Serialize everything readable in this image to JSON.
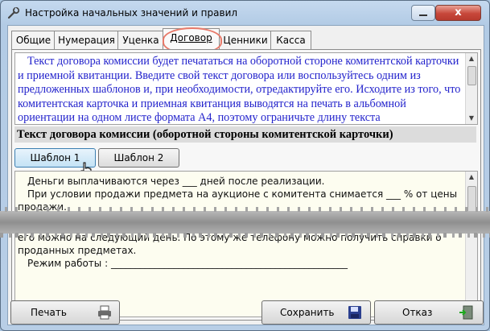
{
  "window": {
    "title": "Настройка начальных значений и правил",
    "close_glyph": "x"
  },
  "tabs": [
    {
      "label": "Общие"
    },
    {
      "label": "Нумерация"
    },
    {
      "label": "Уценка"
    },
    {
      "label": "Договор"
    },
    {
      "label": "Ценники"
    },
    {
      "label": "Касса"
    }
  ],
  "active_tab": "Договор",
  "info_text": "Текст договора комиссии будет печататься на оборотной стороне комитентской карточки и приемной квитанции. Введите свой текст договора или воспользуйтесь одним из предложенных шаблонов и, при необходимости, отредактируйте его. Исходите из того, что комитентская карточка и приемная квитанция выводятся на печать в альбомной ориентации на одном листе формата А4, поэтому ограничьте длину текста",
  "section_title": "Текст договора комиссии (оборотной стороны комитентской карточки)",
  "templates": {
    "btn1": "Шаблон 1",
    "btn2": "Шаблон 2"
  },
  "contract": {
    "line1": "Деньги выплачиваются через ___ дней после реализации.",
    "line2": "При условии продажи предмета на аукционе с комитента снимается ___ % от цены продажи.",
    "line3": "его можно на следующий день. По этому же телефону можно получить справки о проданных предметах.",
    "line4": "Режим работы : _________________________________________________"
  },
  "buttons": {
    "print": "Печать",
    "save": "Сохранить",
    "cancel": "Отказ"
  },
  "colors": {
    "info_text": "#2323cc",
    "active_tab_highlight": "#e87a6a"
  }
}
